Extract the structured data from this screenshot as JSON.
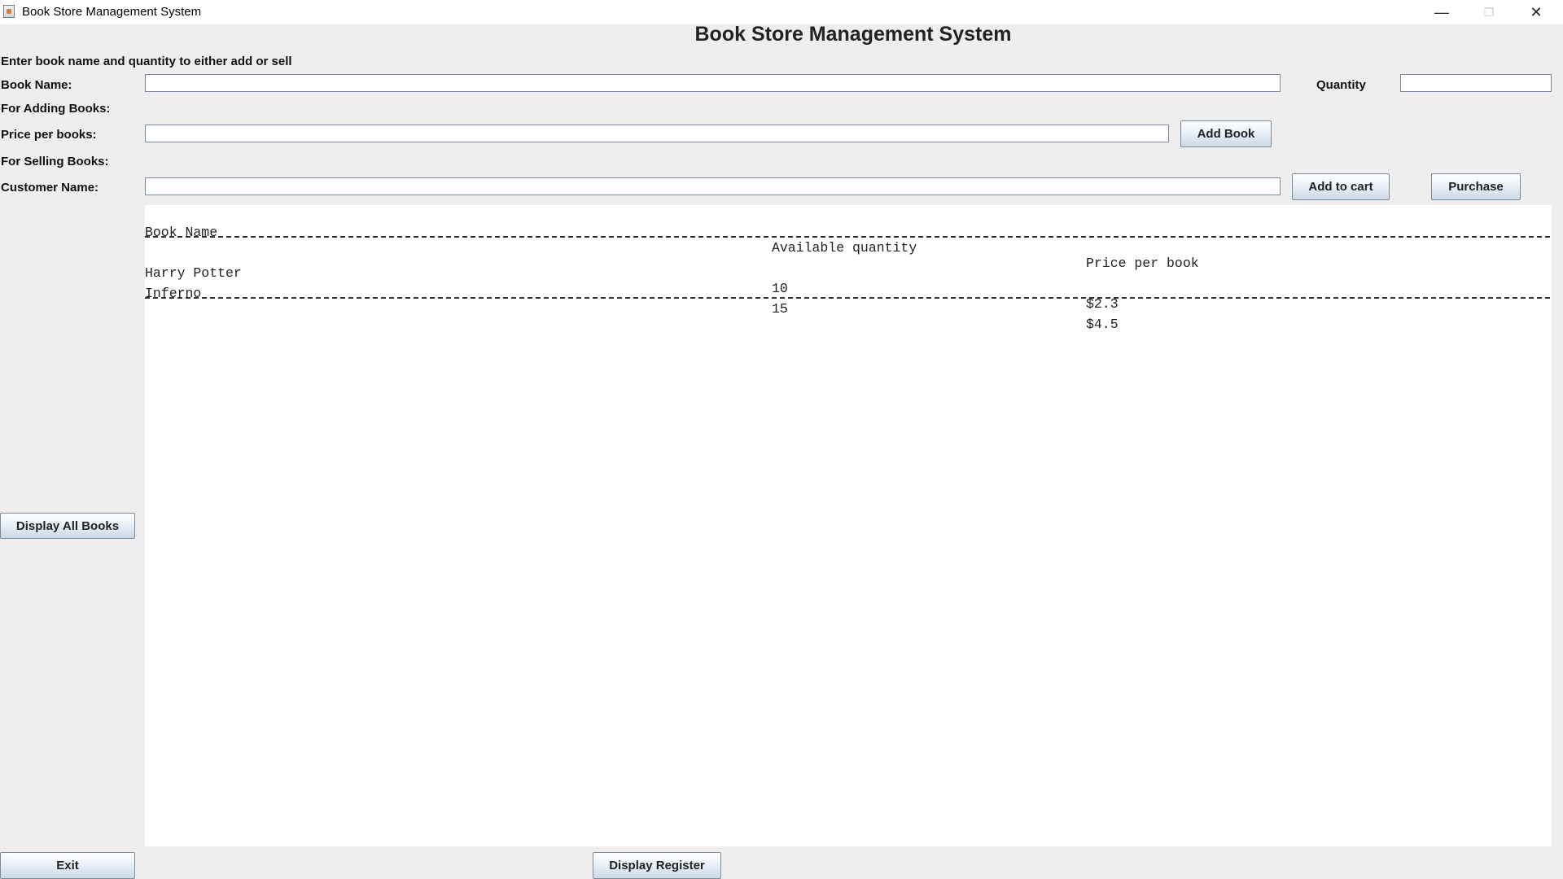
{
  "window": {
    "title": "Book Store Management System",
    "controls": {
      "minimize": "—",
      "maximize": "❐",
      "close": "✕"
    }
  },
  "header": {
    "title": "Book Store Management System"
  },
  "form": {
    "instructions": "Enter book name and quantity to either add or sell",
    "book_name_label": "Book Name:",
    "book_name_value": "",
    "quantity_label": "Quantity",
    "quantity_value": "",
    "adding_section_label": "For Adding Books:",
    "price_label": "Price per books:",
    "price_value": "",
    "add_book_button": "Add Book",
    "selling_section_label": "For Selling Books:",
    "customer_label": "Customer Name:",
    "customer_value": "",
    "add_to_cart_button": "Add to cart",
    "purchase_button": "Purchase"
  },
  "output": {
    "headers": [
      "Book Name",
      "Available quantity",
      "Price per book"
    ],
    "rows": [
      [
        "Harry Potter",
        "10",
        "$2.3"
      ],
      [
        "Inferno",
        "15",
        "$4.5"
      ]
    ]
  },
  "buttons": {
    "display_all_books": "Display All Books",
    "exit": "Exit",
    "display_register": "Display Register"
  }
}
